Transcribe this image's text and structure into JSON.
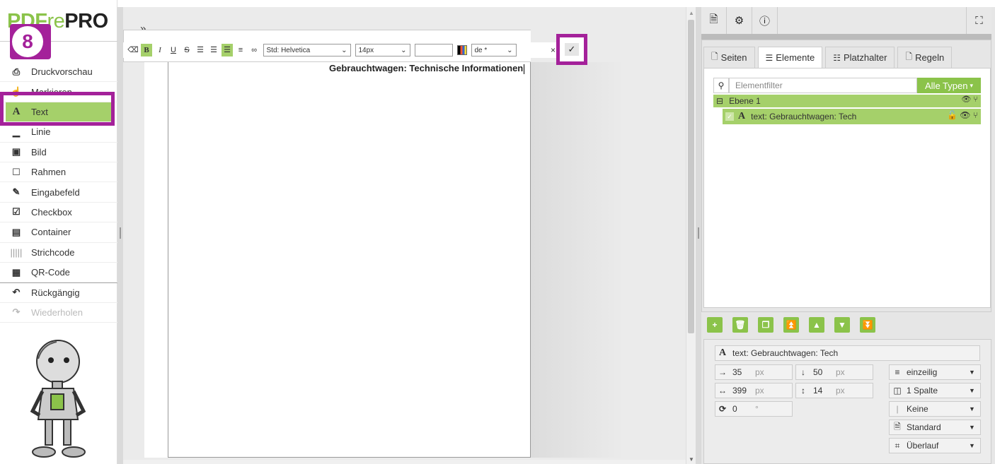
{
  "logo": {
    "part1": "PDF",
    "part2": "re",
    "part3": "PRO"
  },
  "step_badge": "8",
  "tools": [
    {
      "label": "Druckvorschau",
      "icon": "print-icon"
    },
    {
      "label": "Markieren",
      "icon": "select-cursor-icon"
    },
    {
      "label": "Text",
      "icon": "text-icon"
    },
    {
      "label": "Linie",
      "icon": "line-icon"
    },
    {
      "label": "Bild",
      "icon": "image-icon"
    },
    {
      "label": "Rahmen",
      "icon": "frame-icon"
    },
    {
      "label": "Eingabefeld",
      "icon": "input-field-icon"
    },
    {
      "label": "Checkbox",
      "icon": "checkbox-icon"
    },
    {
      "label": "Container",
      "icon": "container-icon"
    },
    {
      "label": "Strichcode",
      "icon": "barcode-icon"
    },
    {
      "label": "QR-Code",
      "icon": "qrcode-icon"
    },
    {
      "label": "Rückgängig",
      "icon": "undo-icon"
    },
    {
      "label": "Wiederholen",
      "icon": "redo-icon"
    }
  ],
  "canvas": {
    "text_content": "Gebrauchtwagen: Technische Informationen"
  },
  "toolbar": {
    "font_value": "Std: Helvetica",
    "size_value": "14px",
    "language_value": "de *",
    "close_label": "×",
    "confirm_label": "✓"
  },
  "right": {
    "tabs": [
      {
        "label": "Seiten",
        "icon": "page-icon"
      },
      {
        "label": "Elemente",
        "icon": "list-icon"
      },
      {
        "label": "Platzhalter",
        "icon": "database-icon"
      },
      {
        "label": "Regeln",
        "icon": "page-icon"
      }
    ],
    "filter_placeholder": "Elementfilter",
    "filter_type": "Alle Typen",
    "layer_label": "Ebene 1",
    "element_label": "text: Gebrauchtwagen: Tech"
  },
  "props": {
    "name": "text: Gebrauchtwagen: Tech",
    "x_value": "35",
    "y_value": "50",
    "width_value": "399",
    "height_value": "14",
    "rotation_value": "0",
    "unit_px": "px",
    "unit_deg": "°",
    "line_mode": "einzeilig",
    "columns": "1 Spalte",
    "border": "Keine",
    "style": "Standard",
    "overflow": "Überlauf"
  }
}
